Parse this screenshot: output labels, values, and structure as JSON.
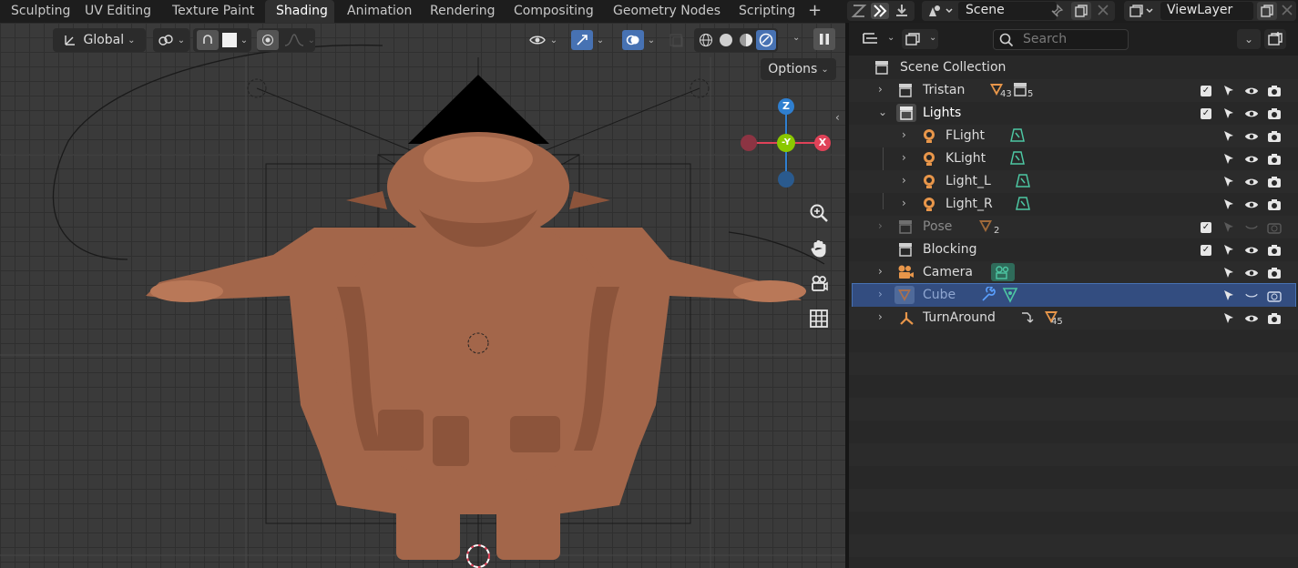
{
  "workspaces": [
    "Sculpting",
    "UV Editing",
    "Texture Paint",
    "Shading",
    "Animation",
    "Rendering",
    "Compositing",
    "Geometry Nodes",
    "Scripting"
  ],
  "active_workspace": "Shading",
  "add_workspace": "+",
  "scene": {
    "name": "Scene"
  },
  "view_layer": {
    "name": "ViewLayer"
  },
  "viewport": {
    "orientation": "Global",
    "options_label": "Options",
    "gizmo_axes": {
      "z": "Z",
      "y": "-Y",
      "x": "X"
    }
  },
  "outliner": {
    "search_placeholder": "Search",
    "rows": [
      {
        "label": "Scene Collection",
        "icon": "collection-icon",
        "expander": ""
      },
      {
        "label": "Tristan",
        "icon": "collection-icon",
        "expander": "›",
        "badge1": "43",
        "badge2": "5"
      },
      {
        "label": "Lights",
        "icon": "collection-icon",
        "expander": "⌄"
      },
      {
        "label": "FLight",
        "icon": "light-icon",
        "expander": "›"
      },
      {
        "label": "KLight",
        "icon": "light-icon",
        "expander": "›"
      },
      {
        "label": "Light_L",
        "icon": "light-icon",
        "expander": "›"
      },
      {
        "label": "Light_R",
        "icon": "light-icon",
        "expander": "›"
      },
      {
        "label": "Pose",
        "icon": "collection-icon",
        "expander": "›",
        "badge1": "2"
      },
      {
        "label": "Blocking",
        "icon": "collection-icon",
        "expander": ""
      },
      {
        "label": "Camera",
        "icon": "camera-icon",
        "expander": "›"
      },
      {
        "label": "Cube",
        "icon": "mesh-icon",
        "expander": "›"
      },
      {
        "label": "TurnAround",
        "icon": "empty-icon",
        "expander": "›",
        "badge1": "45"
      }
    ]
  },
  "colors": {
    "accent": "#4772b3",
    "selection": "#334d80",
    "light_green": "#4dc7a3",
    "orange": "#e8964a",
    "gizmo_x": "#e04258",
    "gizmo_y": "#8ac800",
    "gizmo_z": "#2f7fd0"
  }
}
